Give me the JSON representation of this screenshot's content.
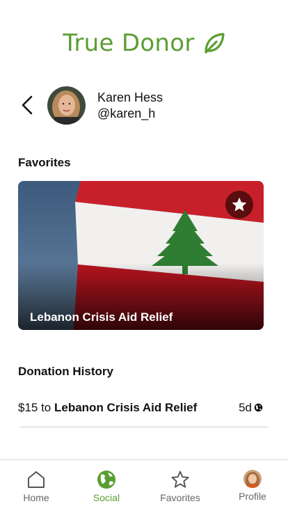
{
  "app": {
    "title": "True Donor"
  },
  "profile": {
    "name": "Karen Hess",
    "handle": "@karen_h"
  },
  "favorites": {
    "heading": "Favorites",
    "items": [
      {
        "title": "Lebanon Crisis Aid Relief",
        "favorited": true
      }
    ]
  },
  "history": {
    "heading": "Donation History",
    "items": [
      {
        "amount_prefix": "$15 to",
        "cause": "Lebanon Crisis Aid Relief",
        "time": "5d",
        "visibility_icon": "globe-icon"
      }
    ]
  },
  "tabs": [
    {
      "label": "Home",
      "icon": "home-icon",
      "active": false
    },
    {
      "label": "Social",
      "icon": "globe-icon",
      "active": true
    },
    {
      "label": "Favorites",
      "icon": "star-icon",
      "active": false
    },
    {
      "label": "Profile",
      "icon": "avatar",
      "active": false
    }
  ],
  "colors": {
    "brand": "#5a9e32",
    "text": "#111111",
    "muted": "#666666"
  }
}
